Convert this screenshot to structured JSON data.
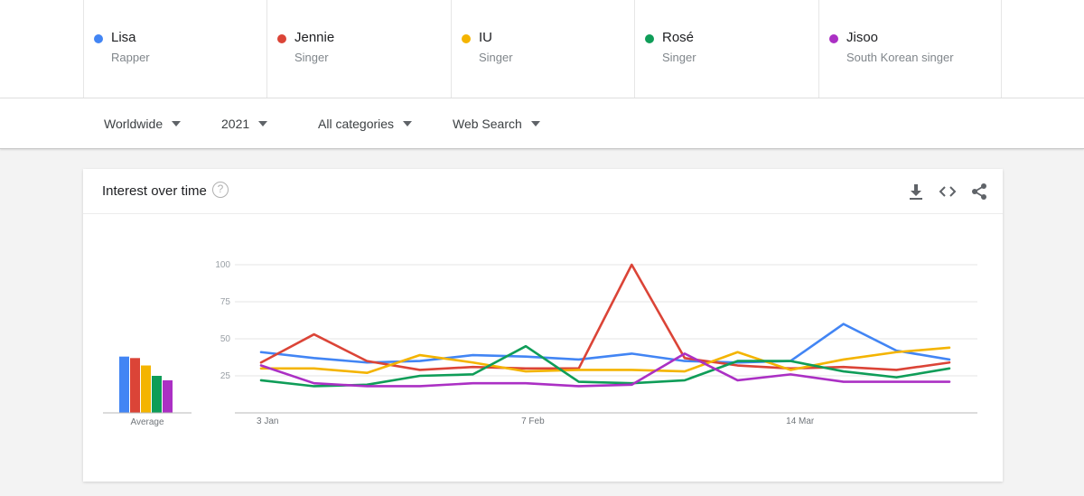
{
  "terms": [
    {
      "name": "Lisa",
      "type": "Rapper",
      "color": "#4285f4"
    },
    {
      "name": "Jennie",
      "type": "Singer",
      "color": "#db4437"
    },
    {
      "name": "IU",
      "type": "Singer",
      "color": "#f4b400"
    },
    {
      "name": "Rosé",
      "type": "Singer",
      "color": "#0f9d58"
    },
    {
      "name": "Jisoo",
      "type": "South Korean singer",
      "color": "#ab30c4"
    }
  ],
  "filters": {
    "region": "Worldwide",
    "period": "2021",
    "category": "All categories",
    "search_type": "Web Search"
  },
  "card": {
    "title": "Interest over time",
    "help_glyph": "?",
    "average_label": "Average"
  },
  "chart_data": {
    "type": "line",
    "yticks": [
      25,
      50,
      75,
      100
    ],
    "ylim": [
      0,
      100
    ],
    "x_tick_labels": [
      "3 Jan",
      "7 Feb",
      "14 Mar"
    ],
    "x_tick_index": [
      0,
      5,
      10
    ],
    "x": [
      0,
      1,
      2,
      3,
      4,
      5,
      6,
      7,
      8,
      9,
      10,
      11,
      12,
      13
    ],
    "series": [
      {
        "name": "Lisa",
        "color": "#4285f4",
        "values": [
          41,
          37,
          34,
          35,
          39,
          38,
          36,
          40,
          35,
          34,
          35,
          60,
          42,
          36
        ]
      },
      {
        "name": "Jennie",
        "color": "#db4437",
        "values": [
          34,
          53,
          35,
          29,
          31,
          30,
          30,
          100,
          37,
          32,
          30,
          31,
          29,
          34
        ]
      },
      {
        "name": "IU",
        "color": "#f4b400",
        "values": [
          30,
          30,
          27,
          39,
          34,
          28,
          29,
          29,
          28,
          41,
          29,
          36,
          41,
          44
        ]
      },
      {
        "name": "Rosé",
        "color": "#0f9d58",
        "values": [
          22,
          18,
          19,
          25,
          26,
          45,
          21,
          20,
          22,
          35,
          35,
          28,
          24,
          30
        ]
      },
      {
        "name": "Jisoo",
        "color": "#ab30c4",
        "values": [
          32,
          20,
          18,
          18,
          20,
          20,
          18,
          19,
          40,
          22,
          26,
          21,
          21,
          21
        ]
      }
    ],
    "averages": [
      38,
      37,
      32,
      25,
      22
    ],
    "grid": true
  }
}
